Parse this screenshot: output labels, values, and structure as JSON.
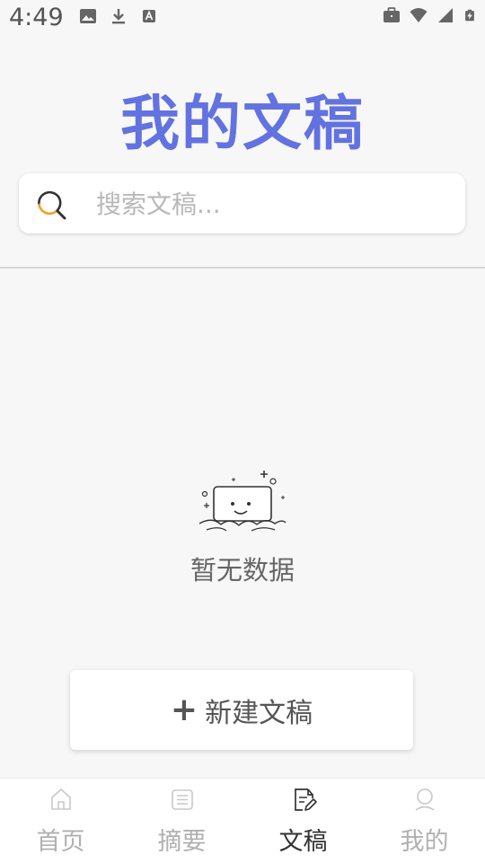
{
  "status_bar": {
    "time": "4:49",
    "left_icons": [
      "image-icon",
      "download-icon",
      "a-badge-icon"
    ],
    "right_icons": [
      "briefcase-icon",
      "wifi-icon",
      "signal-icon",
      "battery-icon"
    ]
  },
  "header": {
    "title": "我的文稿",
    "title_color": "#6272e0"
  },
  "search": {
    "placeholder": "搜索文稿...",
    "value": ""
  },
  "empty_state": {
    "message": "暂无数据"
  },
  "new_button": {
    "plus": "+",
    "label": "新建文稿"
  },
  "bottom_nav": {
    "items": [
      {
        "label": "首页",
        "icon": "home-icon",
        "active": false
      },
      {
        "label": "摘要",
        "icon": "summary-icon",
        "active": false
      },
      {
        "label": "文稿",
        "icon": "document-edit-icon",
        "active": true
      },
      {
        "label": "我的",
        "icon": "profile-icon",
        "active": false
      }
    ]
  }
}
